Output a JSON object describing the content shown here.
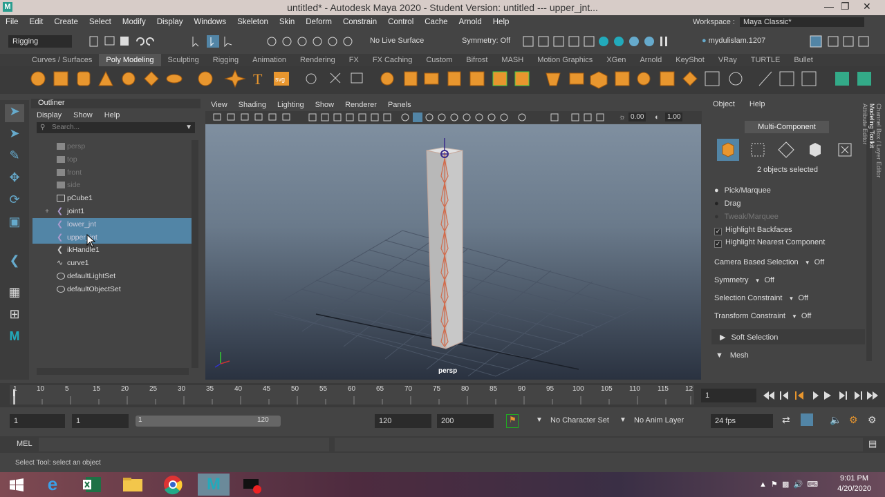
{
  "window": {
    "title": "untitled* - Autodesk Maya 2020 - Student Version: untitled   ---   upper_jnt..."
  },
  "menubar": {
    "items": [
      "File",
      "Edit",
      "Create",
      "Select",
      "Modify",
      "Display",
      "Windows",
      "Skeleton",
      "Skin",
      "Deform",
      "Constrain",
      "Control",
      "Cache",
      "Arnold",
      "Help"
    ],
    "workspace_label": "Workspace :",
    "workspace_value": "Maya Classic*"
  },
  "statusline": {
    "mode": "Rigging",
    "live_surface": "No Live Surface",
    "symmetry": "Symmetry: Off",
    "user": "mydulislam.1207"
  },
  "shelf": {
    "tabs": [
      "Curves / Surfaces",
      "Poly Modeling",
      "Sculpting",
      "Rigging",
      "Animation",
      "Rendering",
      "FX",
      "FX Caching",
      "Custom",
      "Bifrost",
      "MASH",
      "Motion Graphics",
      "XGen",
      "Arnold",
      "KeyShot",
      "VRay",
      "TURTLE",
      "Bullet"
    ],
    "active_tab": "Poly Modeling",
    "svg_label": "svg"
  },
  "outliner": {
    "title": "Outliner",
    "menus": [
      "Display",
      "Show",
      "Help"
    ],
    "search_placeholder": "Search...",
    "items": [
      {
        "label": "persp",
        "dim": true,
        "icon": "camera-icon"
      },
      {
        "label": "top",
        "dim": true,
        "icon": "camera-icon"
      },
      {
        "label": "front",
        "dim": true,
        "icon": "camera-icon"
      },
      {
        "label": "side",
        "dim": true,
        "icon": "camera-icon"
      },
      {
        "label": "pCube1",
        "icon": "mesh-icon"
      },
      {
        "label": "joint1",
        "icon": "joint-icon",
        "expand": "+"
      },
      {
        "label": "lower_jnt",
        "selected": true,
        "icon": "joint-icon"
      },
      {
        "label": "upper_jnt",
        "selected": true,
        "icon": "joint-icon"
      },
      {
        "label": "ikHandle1",
        "icon": "ik-handle-icon"
      },
      {
        "label": "curve1",
        "icon": "curve-icon"
      },
      {
        "label": "defaultLightSet",
        "icon": "set-icon"
      },
      {
        "label": "defaultObjectSet",
        "icon": "set-icon"
      }
    ]
  },
  "viewport": {
    "menus": [
      "View",
      "Shading",
      "Lighting",
      "Show",
      "Renderer",
      "Panels"
    ],
    "camera_label": "persp",
    "near": "0.00",
    "far": "1.00"
  },
  "modeling_toolkit": {
    "menus": [
      "Object",
      "Help"
    ],
    "mode": "Multi-Component",
    "selection_status": "2 objects selected",
    "pick_marquee": "Pick/Marquee",
    "drag": "Drag",
    "tweak_marquee": "Tweak/Marquee",
    "highlight_backfaces": "Highlight Backfaces",
    "highlight_nearest": "Highlight Nearest Component",
    "camera_based_selection": "Camera Based Selection",
    "camera_based_value": "Off",
    "symmetry": "Symmetry",
    "symmetry_value": "Off",
    "selection_constraint": "Selection Constraint",
    "selection_constraint_value": "Off",
    "transform_constraint": "Transform Constraint",
    "transform_constraint_value": "Off",
    "soft_selection": "Soft Selection",
    "mesh": "Mesh",
    "side_tabs": [
      "Channel Box / Layer Editor",
      "Modeling Toolkit",
      "Attribute Editor"
    ]
  },
  "timeline": {
    "ticks": [
      "1",
      "5",
      "10",
      "15",
      "20",
      "25",
      "30",
      "35",
      "40",
      "45",
      "50",
      "55",
      "60",
      "65",
      "70",
      "75",
      "80",
      "85",
      "90",
      "95",
      "100",
      "105",
      "110",
      "115",
      "12"
    ],
    "current_frame": "1"
  },
  "range": {
    "start": "1",
    "playback_start": "1",
    "slider_start": "1",
    "slider_end": "120",
    "playback_end": "120",
    "end": "200",
    "character_set": "No Character Set",
    "anim_layer": "No Anim Layer",
    "fps": "24 fps"
  },
  "mel": {
    "label": "MEL"
  },
  "helpline": {
    "text": "Select Tool: select an object"
  },
  "taskbar": {
    "time": "9:01 PM",
    "date": "4/20/2020"
  }
}
